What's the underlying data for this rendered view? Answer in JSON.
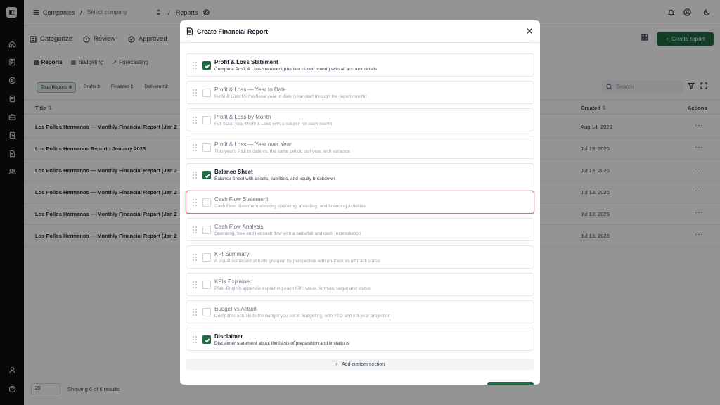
{
  "topbar": {
    "companies": "Companies",
    "company_placeholder": "Select company",
    "separator": "/",
    "reports": "Reports"
  },
  "stages": [
    {
      "label": "Categorize"
    },
    {
      "label": "Review"
    },
    {
      "label": "Approved"
    }
  ],
  "create_report": "Create report",
  "subtabs": [
    {
      "label": "Reports"
    },
    {
      "label": "Budgeting"
    },
    {
      "label": "Forecasting"
    }
  ],
  "filters": [
    {
      "label": "Total Reports",
      "count": "6"
    },
    {
      "label": "Drafts",
      "count": "3"
    },
    {
      "label": "Finalized",
      "count": "1"
    },
    {
      "label": "Delivered",
      "count": "2"
    }
  ],
  "search_placeholder": "Search",
  "table": {
    "headers": {
      "title": "Title",
      "created": "Created",
      "actions": "Actions"
    },
    "rows": [
      {
        "title": "Los Pollos Hermanos — Monthly Financial Report (Jan 2",
        "created": "Aug 14, 2026"
      },
      {
        "title": "Los Pollos Hermanos Report - January 2023",
        "created": "Jul 13, 2026"
      },
      {
        "title": "Los Pollos Hermanos — Monthly Financial Report (Jan 2",
        "created": "Jul 13, 2026"
      },
      {
        "title": "Los Pollos Hermanos — Monthly Financial Report (Jan 2",
        "created": "Jul 13, 2026"
      },
      {
        "title": "Los Pollos Hermanos — Monthly Financial Report (Jan 2",
        "created": "Jul 13, 2026"
      },
      {
        "title": "Los Pollos Hermanos — Monthly Financial Report (Jan 2",
        "created": "Jul 13, 2026"
      }
    ],
    "more": "···"
  },
  "footer": {
    "page_size": "20",
    "showing": "Showing 6 of 6 results"
  },
  "modal": {
    "title": "Create Financial Report",
    "sections": [
      {
        "title": "Profit & Loss Statement",
        "desc": "Complete Profit & Loss statement (the last closed month) with all account details",
        "checked": true
      },
      {
        "title": "Profit & Loss — Year to Date",
        "desc": "Profit & Loss for the fiscal year to date (year start through the report month)",
        "checked": false
      },
      {
        "title": "Profit & Loss by Month",
        "desc": "Full fiscal-year Profit & Loss with a column for each month",
        "checked": false
      },
      {
        "title": "Profit & Loss — Year over Year",
        "desc": "This year's P&L to date vs. the same period last year, with variance",
        "checked": false
      },
      {
        "title": "Balance Sheet",
        "desc": "Balance Sheet with assets, liabilities, and equity breakdown",
        "checked": true
      },
      {
        "title": "Cash Flow Statement",
        "desc": "Cash Flow Statement showing operating, investing, and financing activities",
        "checked": false,
        "highlighted": true
      },
      {
        "title": "Cash Flow Analysis",
        "desc": "Operating, free and net cash flow with a waterfall and cash reconciliation",
        "checked": false
      },
      {
        "title": "KPI Summary",
        "desc": "A visual scorecard of KPIs grouped by perspective with on-track vs off-track status",
        "checked": false
      },
      {
        "title": "KPIs Explained",
        "desc": "Plain-English appendix explaining each KPI: value, formula, target and status",
        "checked": false
      },
      {
        "title": "Budget vs Actual",
        "desc": "Compares actuals to the budget you set in Budgeting, with YTD and full-year projection",
        "checked": false
      },
      {
        "title": "Disclaimer",
        "desc": "Disclaimer statement about the basis of preparation and limitations",
        "checked": true
      }
    ],
    "add_custom": "Add custom section"
  },
  "colors": {
    "accent": "#1f6b46",
    "highlight": "#e06a71"
  }
}
